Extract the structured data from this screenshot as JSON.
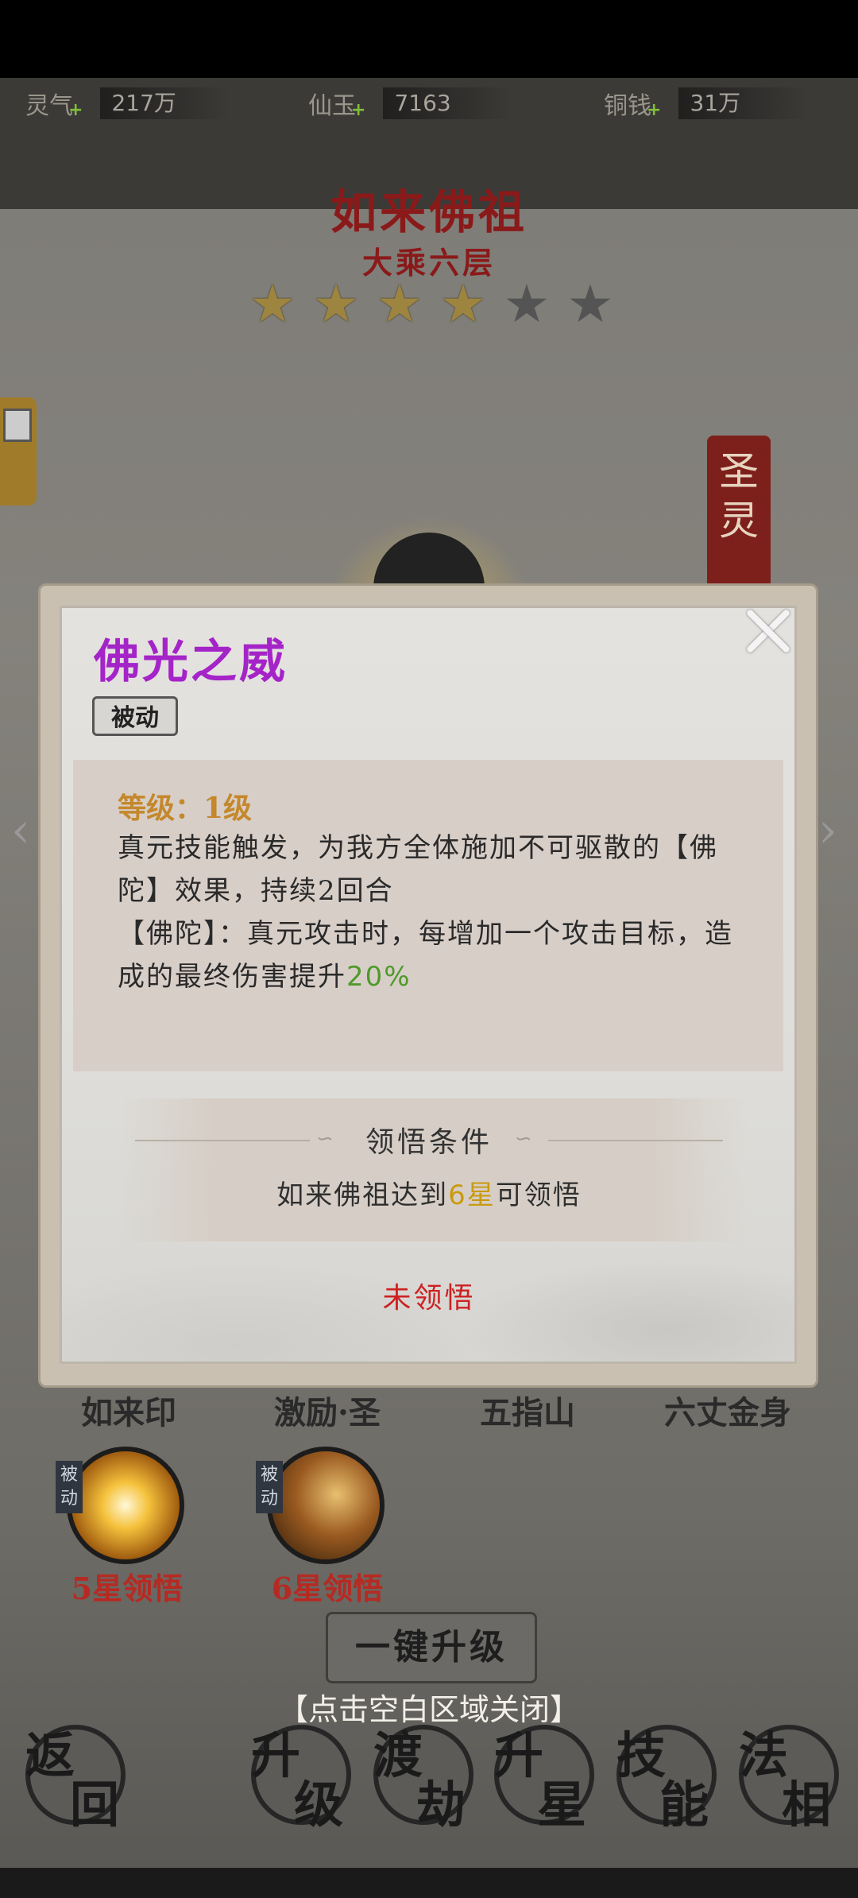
{
  "resources": [
    {
      "label": "灵气",
      "value": "217万"
    },
    {
      "label": "仙玉",
      "value": "7163"
    },
    {
      "label": "铜钱",
      "value": "31万"
    }
  ],
  "hero": {
    "name": "如来佛祖",
    "rank": "大乘六层",
    "stars_filled": 4,
    "stars_total": 6
  },
  "banner_text": "圣灵",
  "skills": [
    {
      "name": "如来印"
    },
    {
      "name": "激励·圣"
    },
    {
      "name": "五指山"
    },
    {
      "name": "六丈金身"
    }
  ],
  "passive_skills": [
    {
      "tag": "被动",
      "unlock": "5星领悟"
    },
    {
      "tag": "被动",
      "unlock": "6星领悟"
    }
  ],
  "upgrade_all_label": "一键升级",
  "close_hint": "【点击空白区域关闭】",
  "nav": [
    {
      "t1": "返",
      "t2": "回"
    },
    {
      "t1": "升",
      "t2": "级"
    },
    {
      "t1": "渡",
      "t2": "劫"
    },
    {
      "t1": "升",
      "t2": "星"
    },
    {
      "t1": "技",
      "t2": "能"
    },
    {
      "t1": "法",
      "t2": "相"
    }
  ],
  "modal": {
    "title": "佛光之威",
    "type": "被动",
    "level": "等级：1级",
    "desc_line1": "真元技能触发，为我方全体施加不可驱散的【佛陀】效果，持续2回合",
    "desc_line2_prefix": "【佛陀】：真元攻击时，每增加一个攻击目标，造成的最终伤害提升",
    "desc_line2_value": "20%",
    "condition_title": "领悟条件",
    "condition_prefix": "如来佛祖达到",
    "condition_value": "6星",
    "condition_suffix": "可领悟",
    "status": "未领悟"
  },
  "colors": {
    "title_purple": "#a424c8",
    "level_gold": "#c4882c",
    "highlight_green": "#4e9a2a",
    "status_red": "#cc2222",
    "hero_red": "#8a1a1a"
  }
}
